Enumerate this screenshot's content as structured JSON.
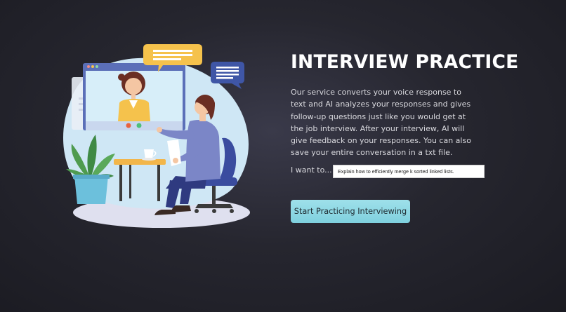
{
  "main": {
    "title": "INTERVIEW PRACTICE",
    "description": "Our service converts your voice response to text and AI analyzes your responses and gives follow-up questions just like you would get at the job interview. After your interview, AI will give feedback on your responses. You can also save your entire conversation in a txt file.",
    "want_label": "I want to...",
    "want_input_value": "Explain how to efficiently merge k sorted linked lists.",
    "start_button_label": "Start Practicing Interviewing"
  },
  "illustration": {
    "icons": [
      "video-call-window-icon",
      "interviewer-avatar-icon",
      "chat-bubble-icon",
      "document-icon",
      "plant-icon",
      "coffee-cup-icon",
      "office-chair-icon"
    ],
    "colors": {
      "blob": "#cfe7f5",
      "window_frame": "#5b6fb8",
      "bubble_yellow": "#f5c24c",
      "bubble_blue": "#3f56a6",
      "blazer": "#7b86c7",
      "chair": "#3a4c9f"
    }
  },
  "colors": {
    "accent_button": "#8fd8e4",
    "background": "#23232b",
    "title": "#ffffff"
  }
}
